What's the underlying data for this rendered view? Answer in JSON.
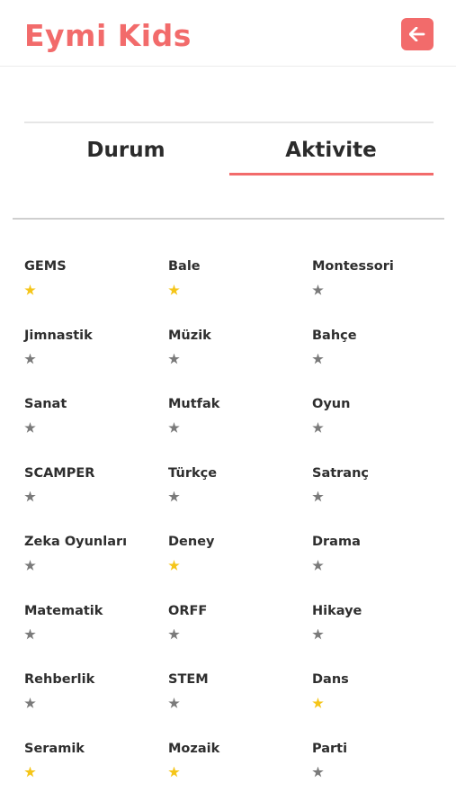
{
  "app": {
    "title": "Eymi Kids"
  },
  "colors": {
    "accent": "#f26b6b",
    "star_on": "#f5c518",
    "star_off": "#7a7a7a"
  },
  "header": {
    "back_icon": "arrow-left-icon"
  },
  "tabs": [
    {
      "label": "Durum",
      "active": false
    },
    {
      "label": "Aktivite",
      "active": true
    }
  ],
  "activities": [
    {
      "name": "GEMS",
      "starred": true
    },
    {
      "name": "Bale",
      "starred": true
    },
    {
      "name": "Montessori",
      "starred": false
    },
    {
      "name": "Jimnastik",
      "starred": false
    },
    {
      "name": "Müzik",
      "starred": false
    },
    {
      "name": "Bahçe",
      "starred": false
    },
    {
      "name": "Sanat",
      "starred": false
    },
    {
      "name": "Mutfak",
      "starred": false
    },
    {
      "name": "Oyun",
      "starred": false
    },
    {
      "name": "SCAMPER",
      "starred": false
    },
    {
      "name": "Türkçe",
      "starred": false
    },
    {
      "name": "Satranç",
      "starred": false
    },
    {
      "name": "Zeka Oyunları",
      "starred": false
    },
    {
      "name": "Deney",
      "starred": true
    },
    {
      "name": "Drama",
      "starred": false
    },
    {
      "name": "Matematik",
      "starred": false
    },
    {
      "name": "ORFF",
      "starred": false
    },
    {
      "name": "Hikaye",
      "starred": false
    },
    {
      "name": "Rehberlik",
      "starred": false
    },
    {
      "name": "STEM",
      "starred": false
    },
    {
      "name": "Dans",
      "starred": true
    },
    {
      "name": "Seramik",
      "starred": true
    },
    {
      "name": "Mozaik",
      "starred": true
    },
    {
      "name": "Parti",
      "starred": false
    }
  ]
}
